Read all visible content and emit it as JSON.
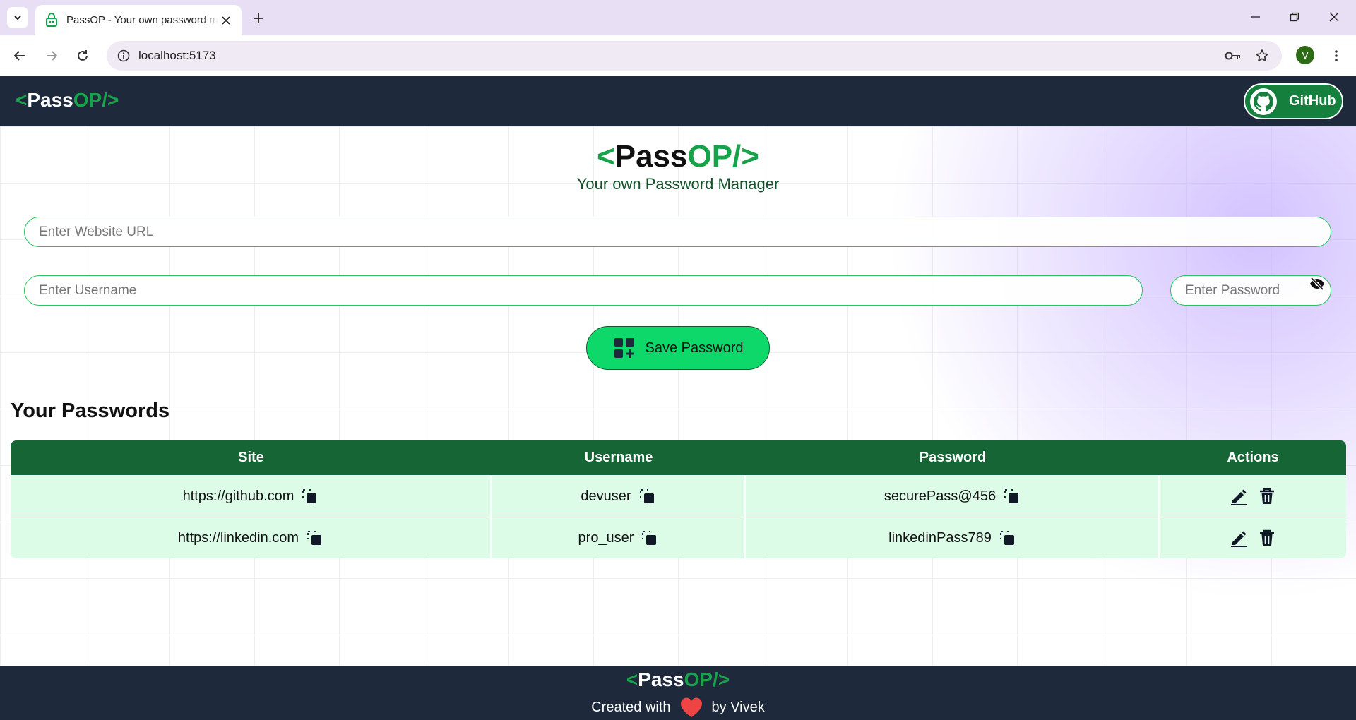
{
  "browser": {
    "tab_title": "PassOP - Your own password manager",
    "url": "localhost:5173",
    "profile_initial": "V"
  },
  "nav": {
    "logo_lt": "<",
    "logo_pass": "Pass",
    "logo_op": "OP/>",
    "github_label": "GitHub"
  },
  "hero": {
    "logo_lt": "<",
    "logo_pass": "Pass",
    "logo_op": "OP/>",
    "subtitle": "Your own Password Manager"
  },
  "form": {
    "url_placeholder": "Enter Website URL",
    "username_placeholder": "Enter Username",
    "password_placeholder": "Enter Password",
    "save_label": "Save Password"
  },
  "passwords": {
    "title": "Your Passwords",
    "columns": [
      "Site",
      "Username",
      "Password",
      "Actions"
    ],
    "rows": [
      {
        "site": "https://github.com",
        "username": "devuser",
        "password": "securePass@456"
      },
      {
        "site": "https://linkedin.com",
        "username": "pro_user",
        "password": "linkedinPass789"
      }
    ]
  },
  "footer": {
    "logo_lt": "<",
    "logo_pass": "Pass",
    "logo_op": "OP/>",
    "created_with": "Created with",
    "by": "by Vivek"
  },
  "icons": {
    "favicon": "robot-lock-icon",
    "eye": "eye-slash-icon",
    "save": "grid-plus-icon",
    "copy": "copy-icon",
    "edit": "pencil-icon",
    "delete": "trash-icon",
    "heart": "heart-icon"
  },
  "colors": {
    "accent_green": "#16a34a",
    "navbar_bg": "#1e293b",
    "table_header": "#166534",
    "table_row": "#dcfce7",
    "save_button": "#0fd86a",
    "heart": "#ef4444"
  }
}
